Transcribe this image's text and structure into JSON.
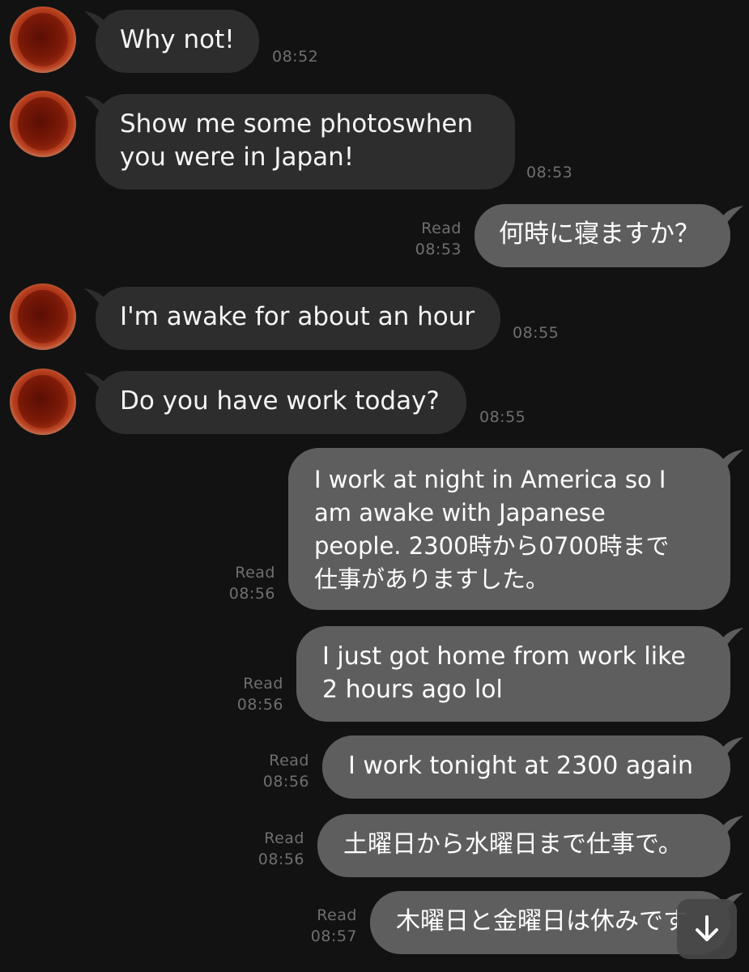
{
  "messages": [
    {
      "side": "in",
      "text": "Why not!",
      "time": "08:52"
    },
    {
      "side": "in",
      "text": "Show me some photoswhen\nyou were in Japan!",
      "time": "08:53"
    },
    {
      "side": "out",
      "text": "何時に寝ますか？",
      "read": "Read",
      "time": "08:53"
    },
    {
      "side": "in",
      "text": "I'm awake for about an hour",
      "time": "08:55"
    },
    {
      "side": "in",
      "text": "Do you have work today?",
      "time": "08:55"
    },
    {
      "side": "out",
      "text": "I work at night in America so I\nam awake with Japanese\npeople. 2300時から0700時まで\n仕事がありますした。",
      "read": "Read",
      "time": "08:56"
    },
    {
      "side": "out",
      "text": "I just got home from work like\n2 hours ago lol",
      "read": "Read",
      "time": "08:56"
    },
    {
      "side": "out",
      "text": "I work tonight at 2300 again",
      "read": "Read",
      "time": "08:56"
    },
    {
      "side": "out",
      "text": "土曜日から水曜日まで仕事で。",
      "read": "Read",
      "time": "08:56"
    },
    {
      "side": "out",
      "text": "木曜日と金曜日は休みです",
      "read": "Read",
      "time": "08:57"
    }
  ],
  "scroll_button": {
    "icon": "arrow-down-icon"
  },
  "colors": {
    "background": "#121212",
    "incoming_bubble": "#2d2d2d",
    "outgoing_bubble": "#5e5e5e",
    "timestamp": "#6f6f6f"
  }
}
